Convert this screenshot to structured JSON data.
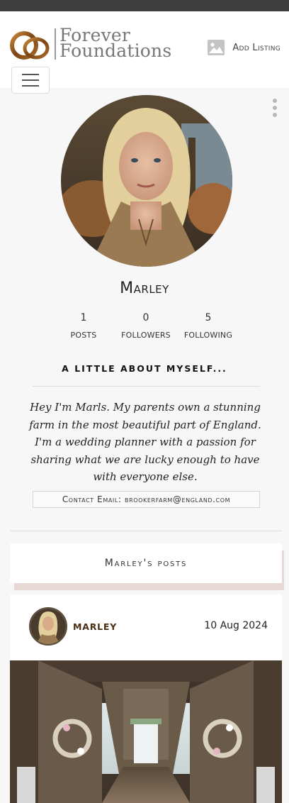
{
  "brand": {
    "name_line1": "Forever",
    "name_line2": "Foundations",
    "logo_icon": "wedding-rings-icon"
  },
  "header": {
    "add_listing_label": "Add Listing",
    "add_listing_icon": "image-icon",
    "menu_icon": "hamburger-icon"
  },
  "profile": {
    "name": "Marley",
    "stats": [
      {
        "value": "1",
        "label": "POSTS"
      },
      {
        "value": "0",
        "label": "FOLLOWERS"
      },
      {
        "value": "5",
        "label": "FOLLOWING"
      }
    ],
    "about_heading": "A LITTLE ABOUT MYSELF...",
    "bio": "Hey I'm Marls. My parents own a stunning farm in the most beautiful part of England. I'm a wedding planner with a passion for sharing what we are lucky enough to have with everyone else.",
    "contact": "Contact Email: brookerfarm@england.com"
  },
  "posts_section": {
    "title": "Marley's posts"
  },
  "posts": [
    {
      "author": "MARLEY",
      "date": "10 Aug 2024"
    }
  ],
  "colors": {
    "accent": "#4a2e14",
    "banner_shadow": "#e7d7d5",
    "page_bg": "#f7f7f7"
  }
}
